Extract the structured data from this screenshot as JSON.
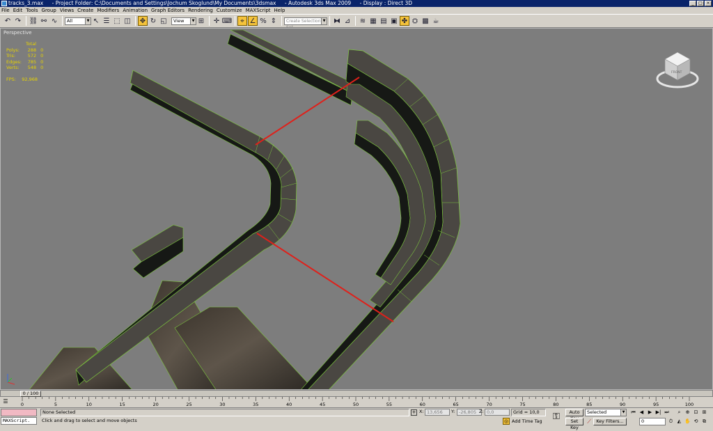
{
  "window": {
    "file": "tracks_3.max",
    "project": "- Project Folder: C:\\Documents and Settings\\Jochum Skoglund\\My Documents\\3dsmax",
    "app": "- Autodesk 3ds Max 2009",
    "display": "- Display : Direct 3D",
    "minimize": "_",
    "maximize": "□",
    "close": "×"
  },
  "menu": [
    "File",
    "Edit",
    "Tools",
    "Group",
    "Views",
    "Create",
    "Modifiers",
    "Animation",
    "Graph Editors",
    "Rendering",
    "Customize",
    "MAXScript",
    "Help"
  ],
  "toolbar": {
    "filter": "All",
    "coord_system": "View",
    "selection_set_placeholder": "Create Selection Set"
  },
  "viewport": {
    "label": "Perspective",
    "stats": {
      "header": "Total",
      "rows": [
        {
          "label": "Polys:",
          "total": "288",
          "sel": "0"
        },
        {
          "label": "Tris:",
          "total": "572",
          "sel": "0"
        },
        {
          "label": "Edges:",
          "total": "785",
          "sel": "0"
        },
        {
          "label": "Verts:",
          "total": "548",
          "sel": "0"
        }
      ],
      "fps_label": "FPS:",
      "fps_value": "92,968"
    },
    "viewcube_label": "FRONT",
    "colors": {
      "background": "#7d7d7d",
      "rail": "#4a4742",
      "rail_dark": "#1a1c18",
      "edge": "#7ec83e",
      "measure": "#e0201a",
      "stats": "#e8d400"
    }
  },
  "timeline": {
    "position": "0 / 100",
    "current_fraction": 0.0,
    "ticks": [
      "0",
      "5",
      "10",
      "15",
      "20",
      "25",
      "30",
      "35",
      "40",
      "45",
      "50",
      "55",
      "60",
      "65",
      "70",
      "75",
      "80",
      "85",
      "90",
      "95",
      "100"
    ]
  },
  "status": {
    "maxscript": "MAXScript.",
    "selection": "None Selected",
    "prompt": "Click and drag to select and move objects",
    "x_label": "X:",
    "x_value": "13,656",
    "y_label": "Y:",
    "y_value": "-26,805",
    "z_label": "Z:",
    "z_value": "0,0",
    "grid": "Grid = 10,0",
    "add_time_tag": "Add Time Tag",
    "auto_key": "Auto Key",
    "set_key": "Set Key",
    "key_mode": "Selected",
    "key_filters": "Key Filters...",
    "frame": "0"
  }
}
